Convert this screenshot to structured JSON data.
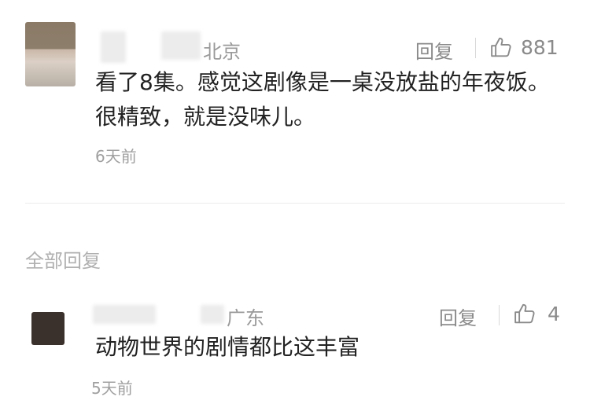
{
  "comment_main": {
    "location": "北京",
    "reply_label": "回复",
    "like_icon": "thumbs-up-icon",
    "like_count": "881",
    "content": "看了8集。感觉这剧像是一桌没放盐的年夜饭。很精致，就是没味儿。",
    "time": "6天前"
  },
  "section": {
    "title": "全部回复"
  },
  "comment_reply": {
    "location": "广东",
    "reply_label": "回复",
    "like_icon": "thumbs-up-icon",
    "like_count": "4",
    "content": "动物世界的剧情都比这丰富",
    "time": "5天前"
  },
  "colors": {
    "text": "#222222",
    "meta": "#8a8a8a",
    "divider": "#ececec"
  }
}
